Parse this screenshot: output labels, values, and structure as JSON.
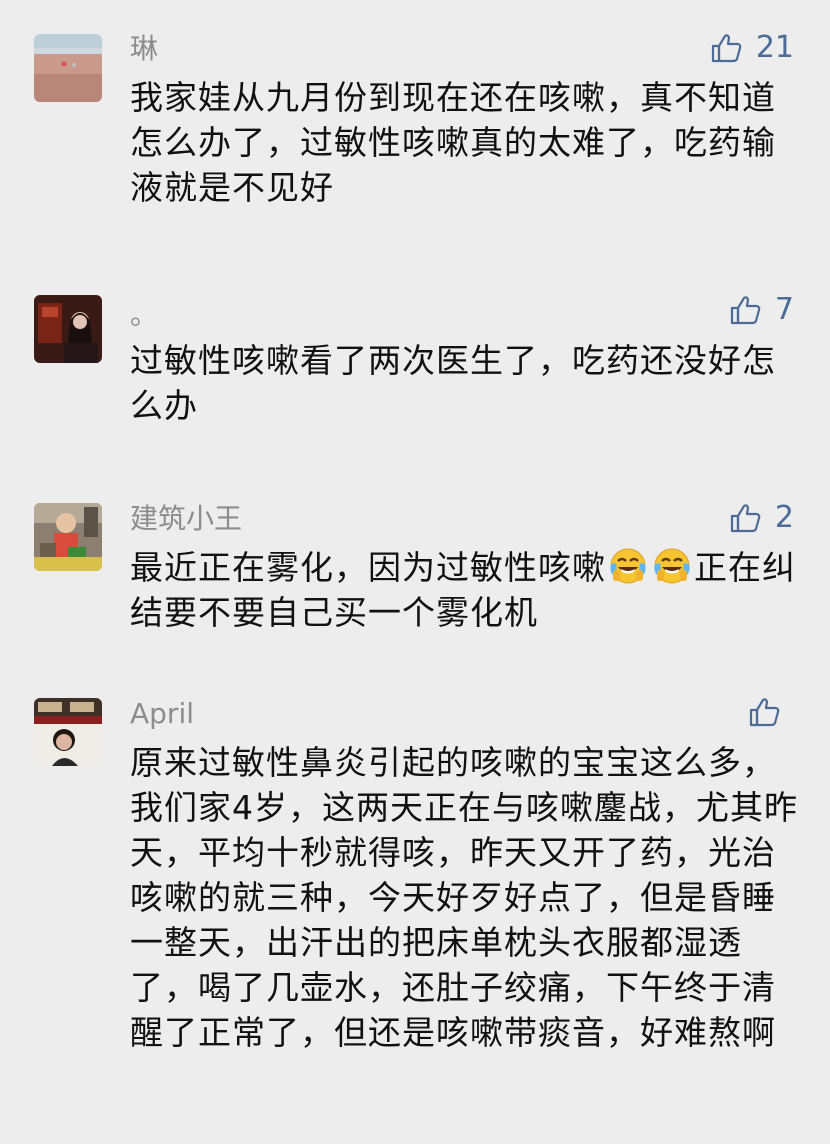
{
  "colors": {
    "background": "#ededed",
    "username": "#8c8c8c",
    "like_accent": "#4c6b96",
    "text": "#111111"
  },
  "comments": [
    {
      "username": "琳",
      "likes": "21",
      "text": "我家娃从九月份到现在还在咳嗽，真不知道怎么办了，过敏性咳嗽真的太难了，吃药输液就是不见好",
      "avatar_icon": "avatar-beach-photo"
    },
    {
      "username": "。",
      "likes": "7",
      "text": "过敏性咳嗽看了两次医生了，吃药还没好怎么办",
      "avatar_icon": "avatar-person-photo"
    },
    {
      "username": "建筑小王",
      "likes": "2",
      "text_before": "最近正在雾化，因为过敏性咳嗽",
      "text_after": "正在纠结要不要自己买一个雾化机",
      "emoji": [
        "crying-laughing-emoji",
        "crying-laughing-emoji"
      ],
      "avatar_icon": "avatar-child-photo"
    },
    {
      "username": "April",
      "likes": "",
      "text": "原来过敏性鼻炎引起的咳嗽的宝宝这么多，我们家4岁，这两天正在与咳嗽鏖战，尤其昨天，平均十秒就得咳，昨天又开了药，光治咳嗽的就三种，今天好歹好点了，但是昏睡一整天，出汗出的把床单枕头衣服都湿透了，喝了几壶水，还肚子绞痛，下午终于清醒了正常了，但还是咳嗽带痰音，好难熬啊",
      "avatar_icon": "avatar-woman-photo"
    }
  ]
}
